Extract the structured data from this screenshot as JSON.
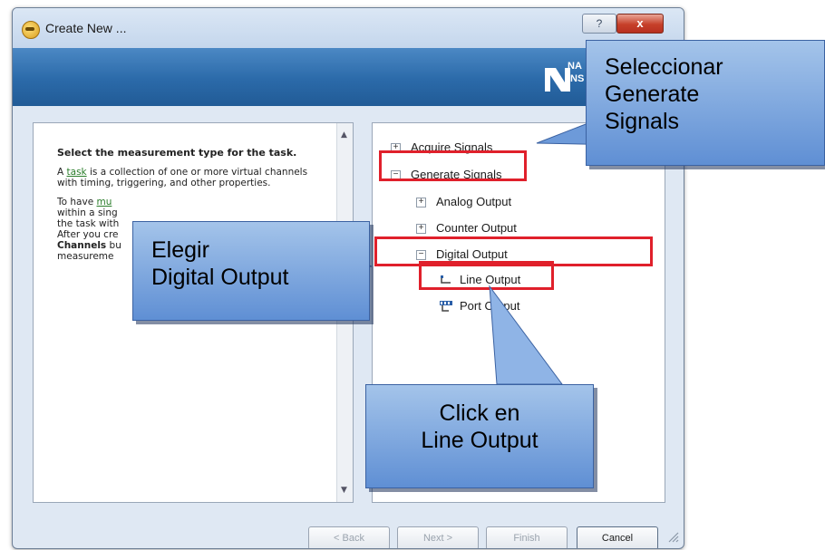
{
  "window": {
    "title": "Create New ...",
    "help_button": "?",
    "close_button": "x",
    "logo_text": "NA\nINS"
  },
  "help_panel": {
    "heading": "Select the measurement type for the task.",
    "para1_prefix": "A ",
    "para1_link": "task",
    "para1_suffix": " is a collection of one or more virtual channels with timing, triggering, and other properties.",
    "para2_line1_prefix": "To have ",
    "para2_line1_link": "mu",
    "para2_line2": "within a sing",
    "para2_line3": "the task with",
    "para2_line4": "After you cre",
    "para2_line5_bold": "Channels",
    "para2_line5_rest": " bu",
    "para2_line6": "measureme"
  },
  "tree": {
    "items": [
      {
        "label": "Acquire Signals",
        "expander": "+"
      },
      {
        "label": "Generate Signals",
        "expander": "−"
      },
      {
        "label": "Analog Output",
        "expander": "+"
      },
      {
        "label": "Counter Output",
        "expander": "+"
      },
      {
        "label": "Digital Output",
        "expander": "−"
      },
      {
        "label": "Line Output"
      },
      {
        "label": "Port Output"
      }
    ]
  },
  "buttons": {
    "back": "< Back",
    "next": "Next >",
    "finish": "Finish",
    "cancel": "Cancel"
  },
  "callouts": {
    "generate": "Seleccionar\nGenerate\nSignals",
    "digital": "Elegir\nDigital Output",
    "line": "Click en\nLine Output"
  },
  "colors": {
    "banner": "#2b6aa9",
    "highlight_box": "#e0202b",
    "callout_fill": "#7aa6e0"
  }
}
